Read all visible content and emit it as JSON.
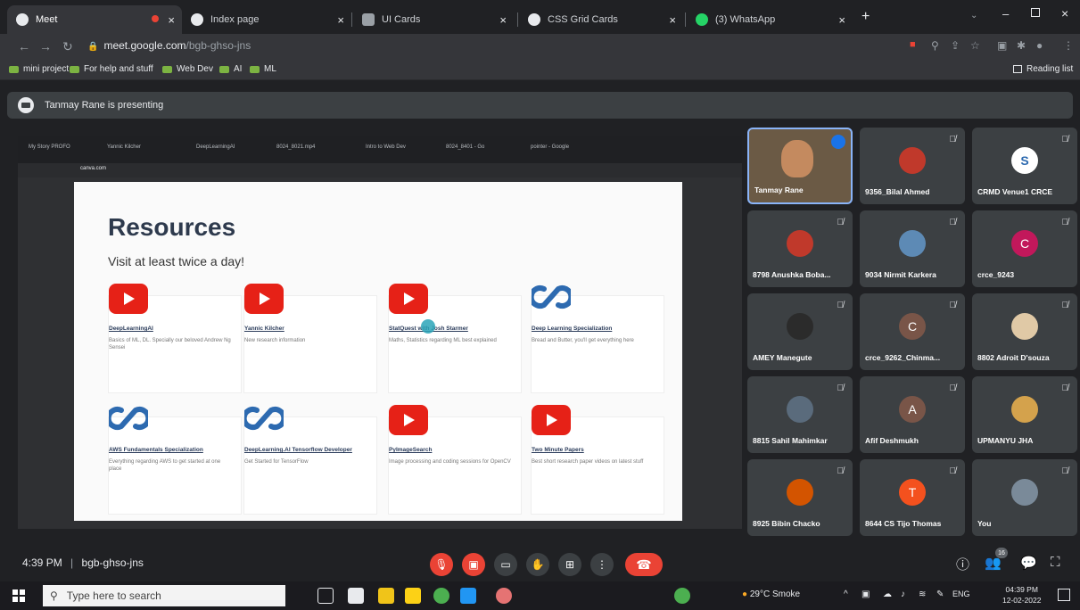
{
  "browser": {
    "tabs": [
      {
        "label": "Meet",
        "color": "#e8eaed"
      },
      {
        "label": "Index page",
        "color": "#e8eaed"
      },
      {
        "label": "UI Cards",
        "color": "#5f6368"
      },
      {
        "label": "CSS Grid Cards",
        "color": "#e8eaed"
      },
      {
        "label": "(3) WhatsApp",
        "color": "#25d366"
      }
    ],
    "new_tab": "+",
    "url_host": "meet.google.com",
    "url_path": "/bgb-ghso-jns",
    "bookmarks": [
      "mini project",
      "For help and stuff",
      "Web Dev",
      "AI",
      "ML"
    ],
    "reading_list": "Reading list"
  },
  "banner": {
    "text": "Tanmay Rane is presenting"
  },
  "share": {
    "tabs": [
      "My Story PROFO",
      "Yannic Kilcher",
      "DeepLearningAI",
      "8024_8021.mp4",
      "Intro to Web Dev",
      "8024_8401 - Go",
      "pointer - Google"
    ],
    "url_host": "canva.com",
    "slide": {
      "title": "Resources",
      "subtitle": "Visit at least twice a day!",
      "cards": [
        {
          "logo": "youtube-logo",
          "title": "DeepLearningAI",
          "desc": "Basics of ML, DL. Specially our beloved Andrew Ng Sensei"
        },
        {
          "logo": "youtube-logo",
          "title": "Yannic Kilcher",
          "desc": "New research information"
        },
        {
          "logo": "youtube-logo",
          "title": "StatQuest with Josh Starmer",
          "desc": "Maths, Statistics regarding ML best explained"
        },
        {
          "logo": "coursera-logo",
          "title": "Deep Learning Specialization",
          "desc": "Bread and Butter, you'll get everything here"
        },
        {
          "logo": "coursera-logo",
          "title": "AWS Fundamentals Specialization",
          "desc": "Everything regarding AWS to get started at one place"
        },
        {
          "logo": "coursera-logo",
          "title": "DeepLearning.AI Tensorflow Developer",
          "desc": "Get Started for TensorFlow"
        },
        {
          "logo": "youtube-logo",
          "title": "PyImageSearch",
          "desc": "Image processing and coding sessions for OpenCV"
        },
        {
          "logo": "youtube-logo",
          "title": "Two Minute Papers",
          "desc": "Best short research paper videos on latest stuff"
        }
      ]
    }
  },
  "participants": [
    {
      "name": "Tanmay Rane",
      "type": "video"
    },
    {
      "name": "9356_Bilal Ahmed",
      "type": "photo",
      "color": "#c0392b"
    },
    {
      "name": "CRMD Venue1 CRCE",
      "type": "photo",
      "color": "#ffffff"
    },
    {
      "name": "8798 Anushka Boba...",
      "type": "photo",
      "color": "#c0392b"
    },
    {
      "name": "9034 Nirmit Karkera",
      "type": "photo",
      "color": "#5d8ab5"
    },
    {
      "name": "crce_9243",
      "type": "letter",
      "letter": "C",
      "color": "#c2185b"
    },
    {
      "name": "AMEY Manegute",
      "type": "photo",
      "color": "#2b2b2b"
    },
    {
      "name": "crce_9262_Chinma...",
      "type": "letter",
      "letter": "C",
      "color": "#795548"
    },
    {
      "name": "8802 Adroit D'souza",
      "type": "photo",
      "color": "#e0c9a6"
    },
    {
      "name": "8815 Sahil Mahimkar",
      "type": "photo",
      "color": "#5a6b7c"
    },
    {
      "name": "Afif Deshmukh",
      "type": "letter",
      "letter": "A",
      "color": "#795548"
    },
    {
      "name": "UPMANYU JHA",
      "type": "photo",
      "color": "#d4a24c"
    },
    {
      "name": "8925 Bibin Chacko",
      "type": "photo",
      "color": "#d35400"
    },
    {
      "name": "8644 CS Tijo Thomas",
      "type": "letter",
      "letter": "T",
      "color": "#f4511e"
    },
    {
      "name": "You",
      "type": "photo",
      "color": "#7a8a99"
    }
  ],
  "meet": {
    "time": "4:39 PM",
    "separator": "|",
    "code": "bgb-ghso-jns",
    "people_count": "16"
  },
  "taskbar": {
    "search_placeholder": "Type here to search",
    "weather": "29°C Smoke",
    "lang": "ENG",
    "time": "04:39 PM",
    "date": "12-02-2022"
  }
}
